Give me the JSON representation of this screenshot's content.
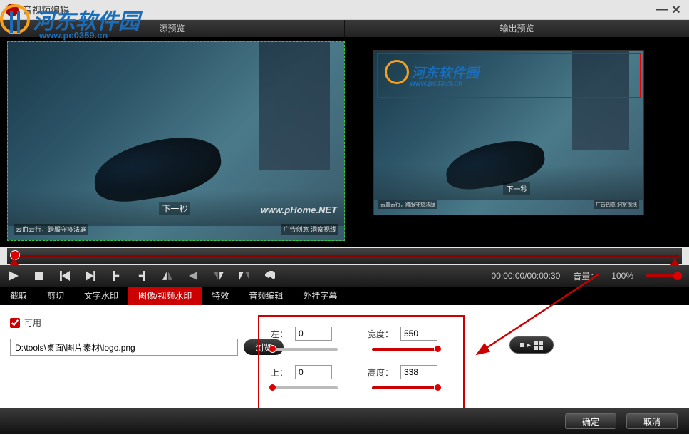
{
  "window": {
    "title": "音视频编辑"
  },
  "background_watermark": {
    "text": "河东软件园",
    "url": "www.pc0359.cn"
  },
  "preview_headers": {
    "source": "源预览",
    "output": "输出预览"
  },
  "preview_content": {
    "next_label": "下一秒",
    "phome_wm": "www.pHome.NET",
    "bottom_left": "云血云行，跨服守疫法庭",
    "bottom_right": "广告创意 洞察视线"
  },
  "output_watermark": {
    "text": "河东软件园",
    "url": "www.pc0359.cn"
  },
  "toolbar": {
    "time": "00:00:00/00:00:30",
    "volume_label": "音量：",
    "volume_value": "100%"
  },
  "tabs": [
    {
      "label": "截取"
    },
    {
      "label": "剪切"
    },
    {
      "label": "文字水印"
    },
    {
      "label": "图像/视频水印",
      "active": true
    },
    {
      "label": "特效"
    },
    {
      "label": "音频编辑"
    },
    {
      "label": "外挂字幕"
    }
  ],
  "watermark_panel": {
    "enable_label": "可用",
    "file_path": "D:\\tools\\桌面\\图片素材\\logo.png",
    "browse_label": "浏览",
    "params": {
      "left": {
        "label": "左：",
        "value": "0",
        "pct": 0
      },
      "top": {
        "label": "上：",
        "value": "0",
        "pct": 0
      },
      "width": {
        "label": "宽度：",
        "value": "550",
        "pct": 100
      },
      "height": {
        "label": "高度：",
        "value": "338",
        "pct": 100
      }
    }
  },
  "footer": {
    "ok": "确定",
    "cancel": "取消"
  }
}
